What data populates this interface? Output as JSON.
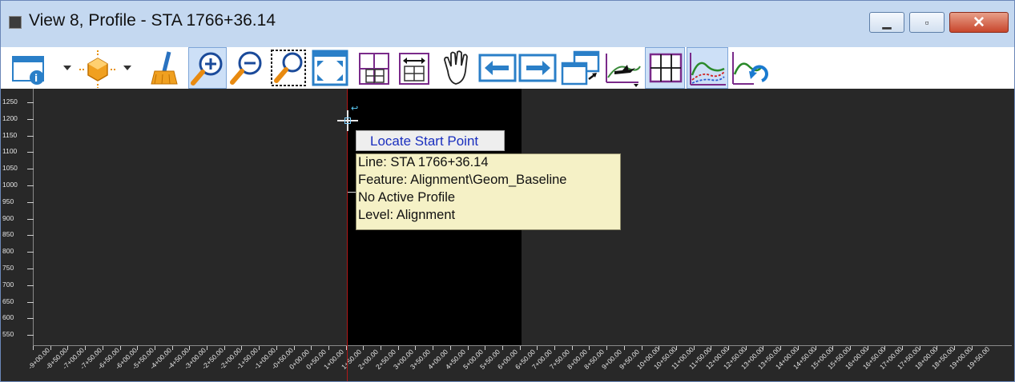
{
  "window": {
    "title": "View 8, Profile - STA 1766+36.14",
    "minimize_glyph": "▁",
    "maximize_glyph": "▫",
    "close_glyph": "✕"
  },
  "toolbar": {
    "icons": [
      "view-attributes-icon",
      "view-display-mode-icon",
      "update-view-icon",
      "zoom-in-icon",
      "zoom-out-icon",
      "window-area-icon",
      "fit-view-icon",
      "grid-icon",
      "exaggeration-icon",
      "pan-icon",
      "previous-view-icon",
      "next-view-icon",
      "copy-view-icon",
      "fly-through-icon",
      "profile-grid-icon",
      "profile-tools-icon",
      "refresh-profile-icon"
    ]
  },
  "profile_view": {
    "y_labels": [
      "1250",
      "1200",
      "1150",
      "1100",
      "1050",
      "1000",
      "950",
      "900",
      "850",
      "800",
      "750",
      "700",
      "650",
      "600",
      "550"
    ],
    "x_labels": [
      "-9+00.00",
      "-8+50.00",
      "-7+00.00",
      "-7+50.00",
      "-6+50.00",
      "-6+00.00",
      "-5+50.00",
      "-4+00.00",
      "-4+50.00",
      "-3+00.00",
      "-2+50.00",
      "-2+00.00",
      "-1+50.00",
      "-1+00.00",
      "-0+50.00",
      "0+00.00",
      "0+50.00",
      "1+00.00",
      "1+50.00",
      "2+00.00",
      "2+50.00",
      "3+00.00",
      "3+50.00",
      "4+00.00",
      "4+50.00",
      "5+00.00",
      "5+50.00",
      "6+00.00",
      "6+50.00",
      "7+00.00",
      "7+50.00",
      "8+00.00",
      "8+50.00",
      "9+00.00",
      "9+50.00",
      "10+00.00",
      "10+50.00",
      "11+00.00",
      "11+50.00",
      "12+00.00",
      "12+50.00",
      "13+00.00",
      "13+50.00",
      "14+00.00",
      "14+50.00",
      "15+00.00",
      "15+50.00",
      "16+00.00",
      "16+50.00",
      "17+00.00",
      "17+50.00",
      "18+00.00",
      "18+50.00",
      "19+00.00",
      "19+50.00"
    ],
    "background_color": "#282828",
    "active_band_color": "#000000",
    "cursor_line_color": "#b01818"
  },
  "prompt": {
    "text": "Locate Start Point"
  },
  "tooltip": {
    "lines": [
      "Line: STA 1766+36.14",
      "Feature:  Alignment\\Geom_Baseline",
      "No Active Profile",
      "Level: Alignment"
    ]
  }
}
